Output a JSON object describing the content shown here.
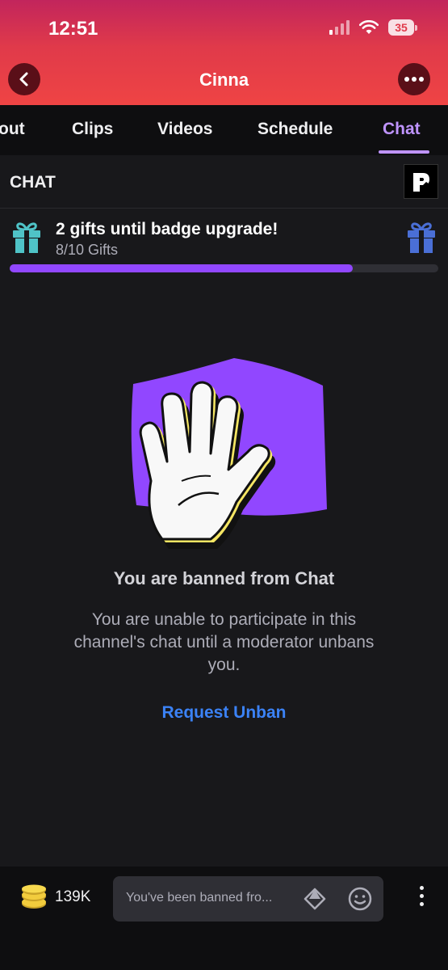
{
  "status_bar": {
    "time": "12:51",
    "battery": "35"
  },
  "header": {
    "title": "Cinna"
  },
  "tabs": [
    {
      "label": "out",
      "active": false
    },
    {
      "label": "Clips",
      "active": false
    },
    {
      "label": "Videos",
      "active": false
    },
    {
      "label": "Schedule",
      "active": false
    },
    {
      "label": "Chat",
      "active": true
    }
  ],
  "chat_header": {
    "title": "CHAT"
  },
  "gift_progress": {
    "title": "2 gifts until badge upgrade!",
    "subtitle": "8/10 Gifts",
    "progress_fraction": 0.8
  },
  "ban_notice": {
    "title": "You are banned from Chat",
    "message": "You are unable to participate in this channel's chat until a moderator unbans you.",
    "action": "Request Unban"
  },
  "bottom_bar": {
    "coins": "139K",
    "input_placeholder": "You've been banned fro..."
  },
  "colors": {
    "accent_purple": "#9147ff",
    "active_tab": "#bf94ff",
    "link_blue": "#3b82f6",
    "header_gradient_top": "#c2255c",
    "header_gradient_bottom": "#ef4444",
    "gift_teal": "#4fc3c7",
    "gift_blue": "#4a6fd6"
  },
  "icons": [
    "back-chevron-icon",
    "more-options-icon",
    "streamer-logo-icon",
    "gift-icon",
    "hand-stop-icon",
    "coins-icon",
    "diamond-icon",
    "emote-smile-icon",
    "kebab-menu-icon"
  ]
}
